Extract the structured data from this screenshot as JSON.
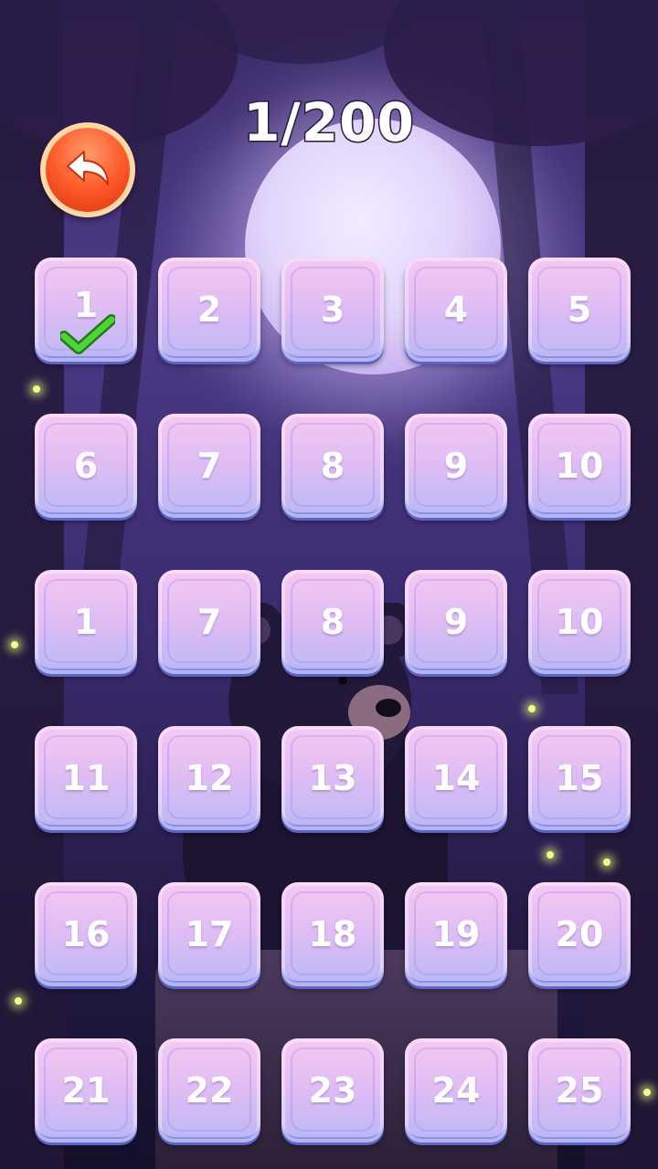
{
  "header": {
    "level_counter": "1/200"
  },
  "back_button": {
    "icon": "back-arrow-icon",
    "color": "#ff5a2a"
  },
  "tile_colors": {
    "top": "#f6c8f3",
    "bottom": "#b9b6f5",
    "border": "#5e63c6"
  },
  "levels": [
    {
      "label": "1",
      "completed": true
    },
    {
      "label": "2",
      "completed": false
    },
    {
      "label": "3",
      "completed": false
    },
    {
      "label": "4",
      "completed": false
    },
    {
      "label": "5",
      "completed": false
    },
    {
      "label": "6",
      "completed": false
    },
    {
      "label": "7",
      "completed": false
    },
    {
      "label": "8",
      "completed": false
    },
    {
      "label": "9",
      "completed": false
    },
    {
      "label": "10",
      "completed": false
    },
    {
      "label": "1",
      "completed": false
    },
    {
      "label": "7",
      "completed": false
    },
    {
      "label": "8",
      "completed": false
    },
    {
      "label": "9",
      "completed": false
    },
    {
      "label": "10",
      "completed": false
    },
    {
      "label": "11",
      "completed": false
    },
    {
      "label": "12",
      "completed": false
    },
    {
      "label": "13",
      "completed": false
    },
    {
      "label": "14",
      "completed": false
    },
    {
      "label": "15",
      "completed": false
    },
    {
      "label": "16",
      "completed": false
    },
    {
      "label": "17",
      "completed": false
    },
    {
      "label": "18",
      "completed": false
    },
    {
      "label": "19",
      "completed": false
    },
    {
      "label": "20",
      "completed": false
    },
    {
      "label": "21",
      "completed": false
    },
    {
      "label": "22",
      "completed": false
    },
    {
      "label": "23",
      "completed": false
    },
    {
      "label": "24",
      "completed": false
    },
    {
      "label": "25",
      "completed": false
    }
  ]
}
